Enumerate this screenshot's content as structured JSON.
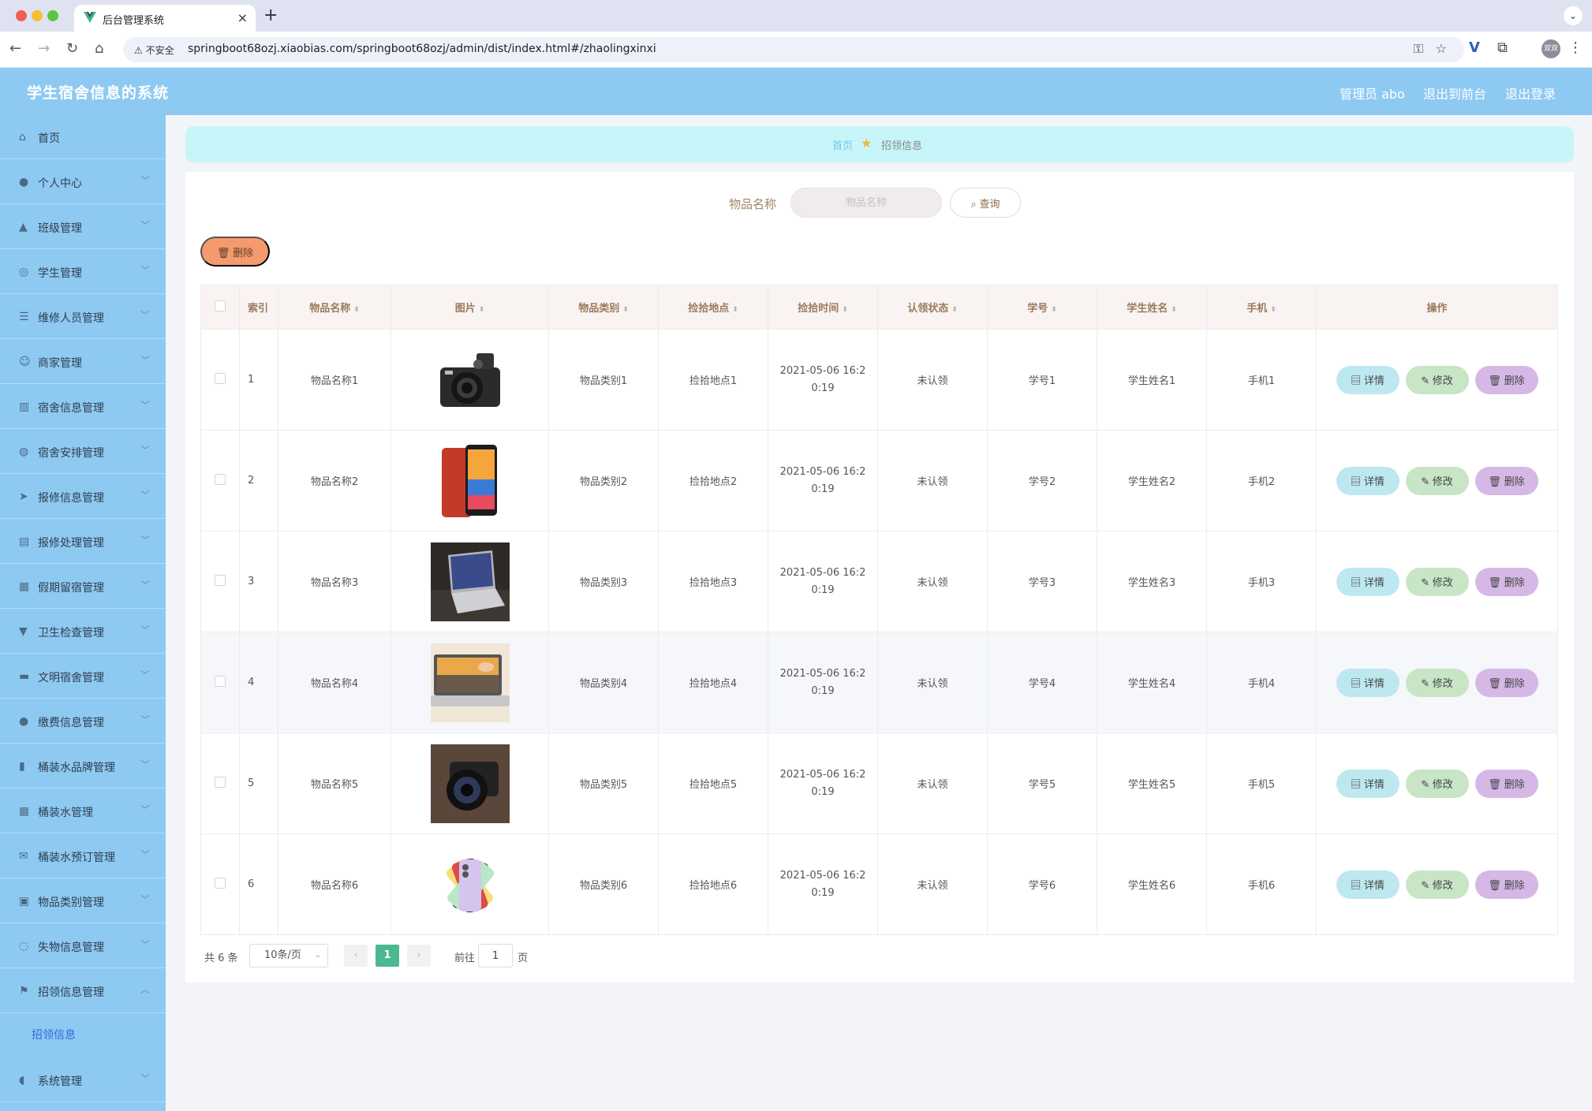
{
  "browser": {
    "tab_title": "后台管理系统",
    "security_label": "不安全",
    "url": "springboot68ozj.xiaobias.com/springboot68ozj/admin/dist/index.html#/zhaolingxinxi",
    "profile_label": "双双"
  },
  "header": {
    "title": "学生宿舍信息的系统",
    "user": "管理员 abo",
    "front": "退出到前台",
    "logout": "退出登录"
  },
  "sidebar": {
    "items": [
      {
        "label": "首页",
        "icon": "home-icon"
      },
      {
        "label": "个人中心",
        "icon": "user-icon"
      },
      {
        "label": "班级管理",
        "icon": "class-icon"
      },
      {
        "label": "学生管理",
        "icon": "compass-icon"
      },
      {
        "label": "维修人员管理",
        "icon": "sliders-icon"
      },
      {
        "label": "商家管理",
        "icon": "smile-icon"
      },
      {
        "label": "宿舍信息管理",
        "icon": "building-icon"
      },
      {
        "label": "宿舍安排管理",
        "icon": "globe-icon"
      },
      {
        "label": "报修信息管理",
        "icon": "send-icon"
      },
      {
        "label": "报修处理管理",
        "icon": "clipboard-icon"
      },
      {
        "label": "假期留宿管理",
        "icon": "grid-icon"
      },
      {
        "label": "卫生检查管理",
        "icon": "brush-icon"
      },
      {
        "label": "文明宿舍管理",
        "icon": "monitor-icon"
      },
      {
        "label": "缴费信息管理",
        "icon": "person-icon"
      },
      {
        "label": "桶装水品牌管理",
        "icon": "bar-chart-icon"
      },
      {
        "label": "桶装水管理",
        "icon": "apps-icon"
      },
      {
        "label": "桶装水预订管理",
        "icon": "mail-icon"
      },
      {
        "label": "物品类别管理",
        "icon": "box-icon"
      },
      {
        "label": "失物信息管理",
        "icon": "chat-icon"
      },
      {
        "label": "招领信息管理",
        "icon": "flag-icon"
      }
    ],
    "sub_item": "招领信息",
    "last_item": {
      "label": "系统管理",
      "icon": "mic-icon"
    }
  },
  "breadcrumb": {
    "home": "首页",
    "current": "招领信息"
  },
  "search": {
    "label": "物品名称",
    "placeholder": "物品名称",
    "button": "查询"
  },
  "toolbar": {
    "delete": "删除"
  },
  "table": {
    "headers": [
      "索引",
      "物品名称",
      "图片",
      "物品类别",
      "捡拾地点",
      "捡拾时间",
      "认领状态",
      "学号",
      "学生姓名",
      "手机",
      "操作"
    ],
    "actions": {
      "detail": "详情",
      "edit": "修改",
      "delete": "删除"
    },
    "rows": [
      {
        "index": "1",
        "name": "物品名称1",
        "image": "camera",
        "category": "物品类别1",
        "place": "捡拾地点1",
        "time": "2021-05-06 16:20:19",
        "status": "未认领",
        "sno": "学号1",
        "student": "学生姓名1",
        "phone": "手机1"
      },
      {
        "index": "2",
        "name": "物品名称2",
        "image": "phone",
        "category": "物品类别2",
        "place": "捡拾地点2",
        "time": "2021-05-06 16:20:19",
        "status": "未认领",
        "sno": "学号2",
        "student": "学生姓名2",
        "phone": "手机2"
      },
      {
        "index": "3",
        "name": "物品名称3",
        "image": "laptop",
        "category": "物品类别3",
        "place": "捡拾地点3",
        "time": "2021-05-06 16:20:19",
        "status": "未认领",
        "sno": "学号3",
        "student": "学生姓名3",
        "phone": "手机3"
      },
      {
        "index": "4",
        "name": "物品名称4",
        "image": "laptop2",
        "category": "物品类别4",
        "place": "捡拾地点4",
        "time": "2021-05-06 16:20:19",
        "status": "未认领",
        "sno": "学号4",
        "student": "学生姓名4",
        "phone": "手机4"
      },
      {
        "index": "5",
        "name": "物品名称5",
        "image": "lens",
        "category": "物品类别5",
        "place": "捡拾地点5",
        "time": "2021-05-06 16:20:19",
        "status": "未认领",
        "sno": "学号5",
        "student": "学生姓名5",
        "phone": "手机5"
      },
      {
        "index": "6",
        "name": "物品名称6",
        "image": "iphones",
        "category": "物品类别6",
        "place": "捡拾地点6",
        "time": "2021-05-06 16:20:19",
        "status": "未认领",
        "sno": "学号6",
        "student": "学生姓名6",
        "phone": "手机6"
      }
    ]
  },
  "pagination": {
    "total": "共 6 条",
    "page_size": "10条/页",
    "current": "1",
    "goto": "前往",
    "goto_value": "1",
    "page_unit": "页"
  },
  "colors": {
    "header": "#8ec9f2",
    "breadcrumb": "#c7f6fa",
    "accent": "#4bb88f",
    "delete": "#f59a6e"
  }
}
